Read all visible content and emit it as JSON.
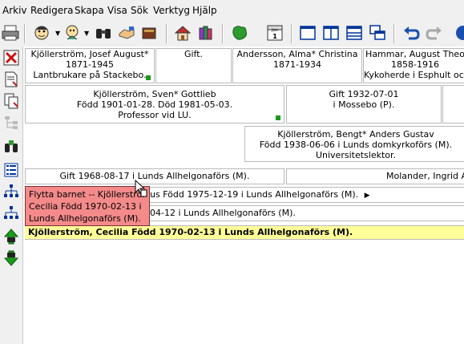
{
  "menu": [
    "Arkiv",
    "Redigera",
    "Skapa",
    "Visa",
    "Sök",
    "Verktyg",
    "Hjälp"
  ],
  "calendar_icon_text": "Jan\n1",
  "row1": {
    "p1": {
      "l1": "Kjöllerström, Josef August*",
      "l2": "1871-1945",
      "l3": "Lantbrukare på Stackebo."
    },
    "gift": "Gift.",
    "p2": {
      "l1": "Andersson, Alma* Christina",
      "l2": "1871-1934"
    },
    "p3": {
      "l1": "Hammar, August Theo",
      "l2": "1858-1916",
      "l3": "Kykoherde i Esphult och E"
    }
  },
  "row2": {
    "p1": {
      "l1": "Kjöllerström, Sven* Gottlieb",
      "l2": "Född 1901-01-28. Död 1981-05-03.",
      "l3": "Professor vid LU."
    },
    "marriage": {
      "l1": "Gift 1932-07-01",
      "l2": "i Mossebo (P)."
    }
  },
  "row3": {
    "p1": {
      "l1": "Kjöllerström, Bengt* Anders Gustav",
      "l2": "Född 1938-06-06 i Lunds domkyrkoförs (M).",
      "l3": "Universitetslektor."
    }
  },
  "row4": {
    "marriage": "Gift 1968-08-17 i Lunds Allhelgonaförs (M).",
    "spouse": "Molander, Ingrid Ann"
  },
  "child1": "us Född 1975-12-19 i Lunds Allhelgonaförs (M).",
  "child1_arrow": "▶",
  "child2": "04-12 i Lunds Allhelgonaförs (M).",
  "selected": "Kjöllerström, Cecilia Född 1970-02-13 i Lunds Allhelgonaförs (M).",
  "tooltip": {
    "l1": "Flytta barnet -- Kjöllerström",
    "l2": "Cecilia Född 1970-02-13 i",
    "l3": "Lunds Allhelgonaförs (M)."
  }
}
